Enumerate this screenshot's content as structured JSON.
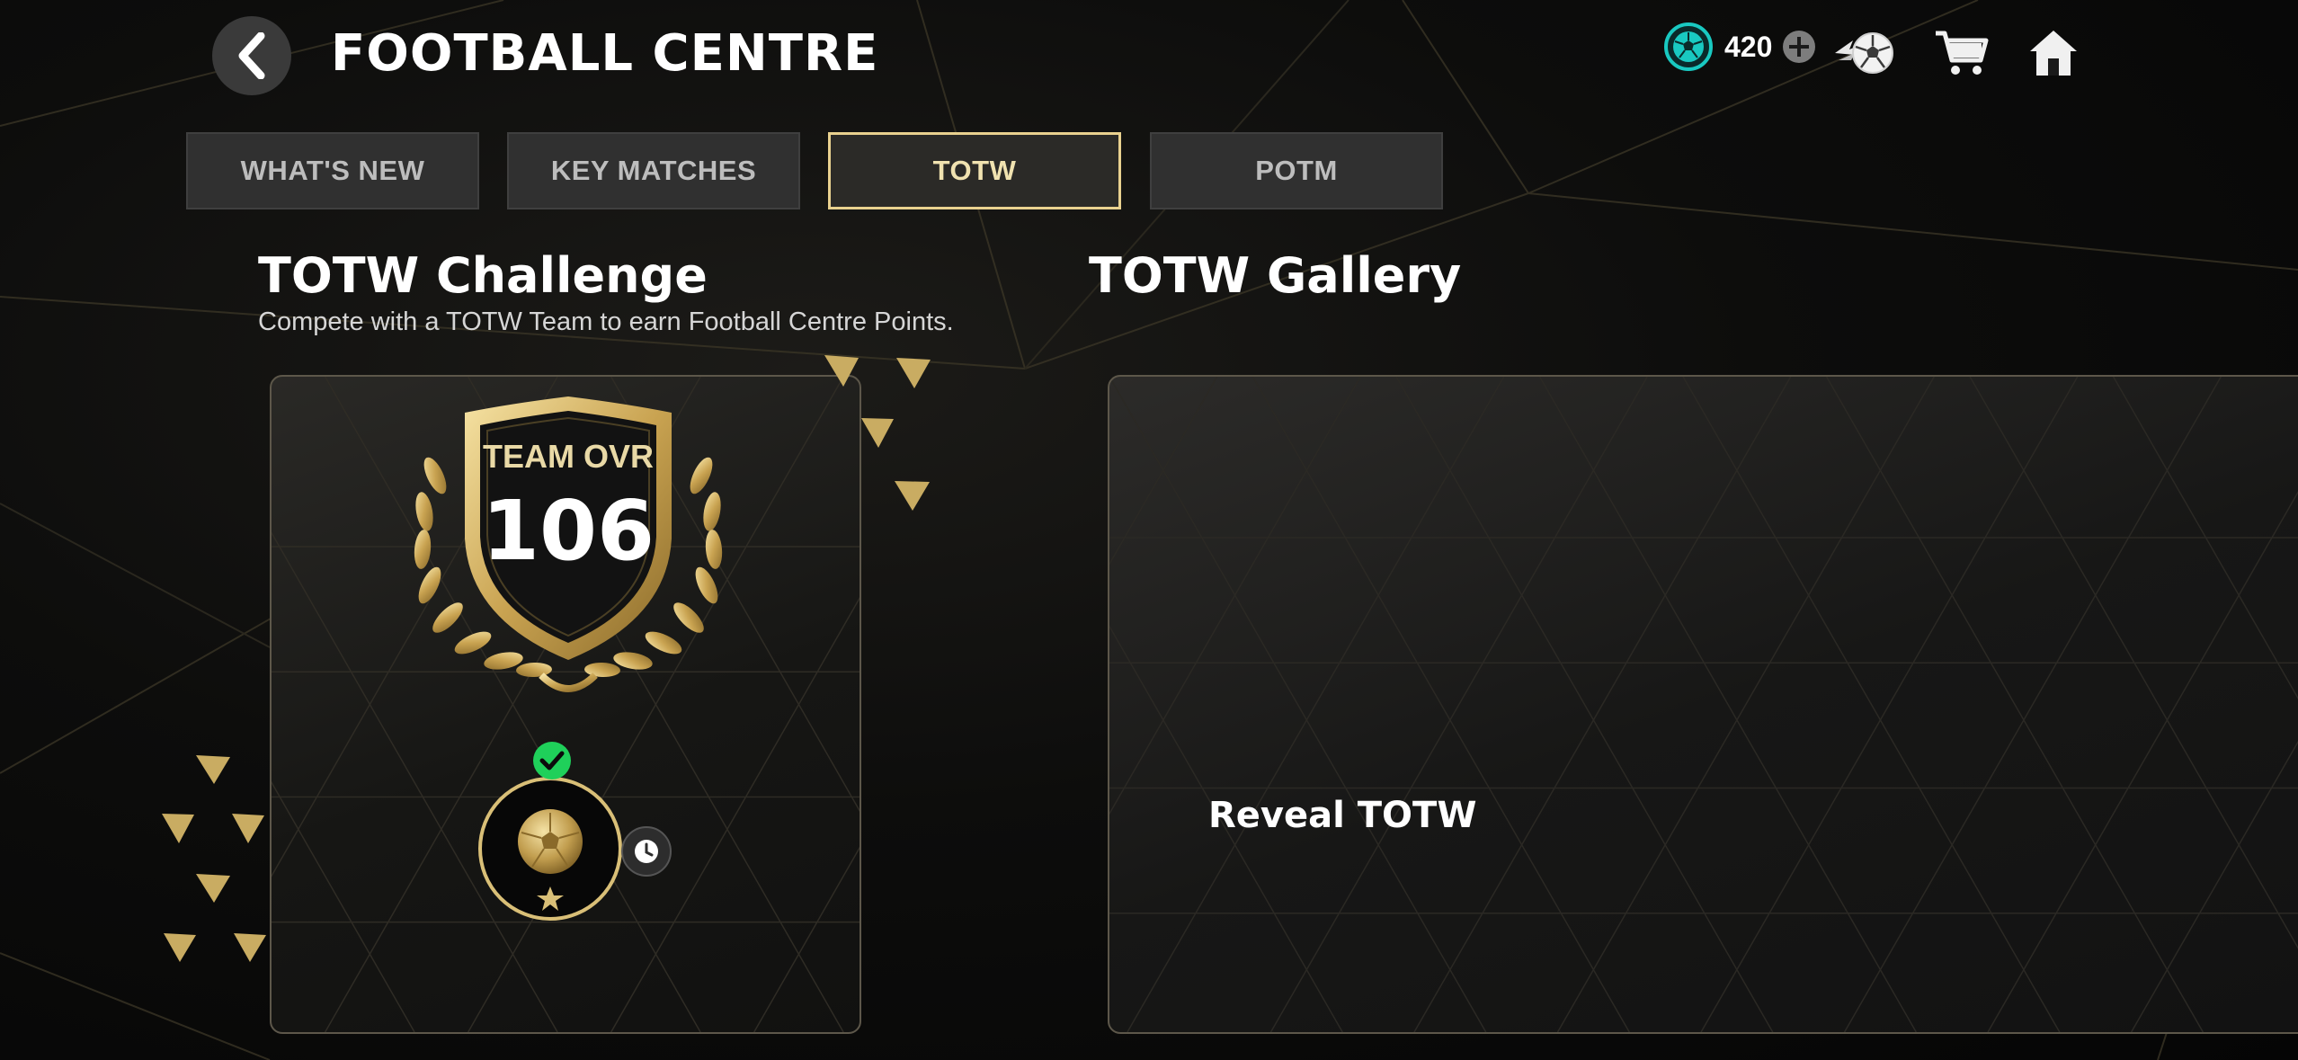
{
  "header": {
    "title": "FOOTBALL CENTRE",
    "currency_value": "420"
  },
  "tabs": [
    {
      "label": "WHAT'S NEW",
      "active": false
    },
    {
      "label": "KEY MATCHES",
      "active": false
    },
    {
      "label": "TOTW",
      "active": true
    },
    {
      "label": "POTM",
      "active": false
    }
  ],
  "challenge": {
    "title": "TOTW Challenge",
    "subtitle": "Compete with a TOTW Team to earn Football Centre Points.",
    "ovr_label": "TEAM OVR",
    "ovr_value": "106"
  },
  "gallery": {
    "title": "TOTW Gallery",
    "reveal_label": "Reveal TOTW"
  },
  "icons": {
    "back": "chevron-left-icon",
    "currency": "football-points-coin-icon",
    "add": "plus-circle-icon",
    "packs": "ball-with-wings-icon",
    "store": "shopping-cart-icon",
    "home": "home-icon",
    "completed": "check-circle-icon",
    "timer": "clock-icon",
    "reward": "gold-ball-icon"
  },
  "colors": {
    "accent_gold": "#e9d18f",
    "currency_teal": "#19c9c1",
    "success_green": "#1fd05a",
    "tab_bg": "#303030"
  }
}
